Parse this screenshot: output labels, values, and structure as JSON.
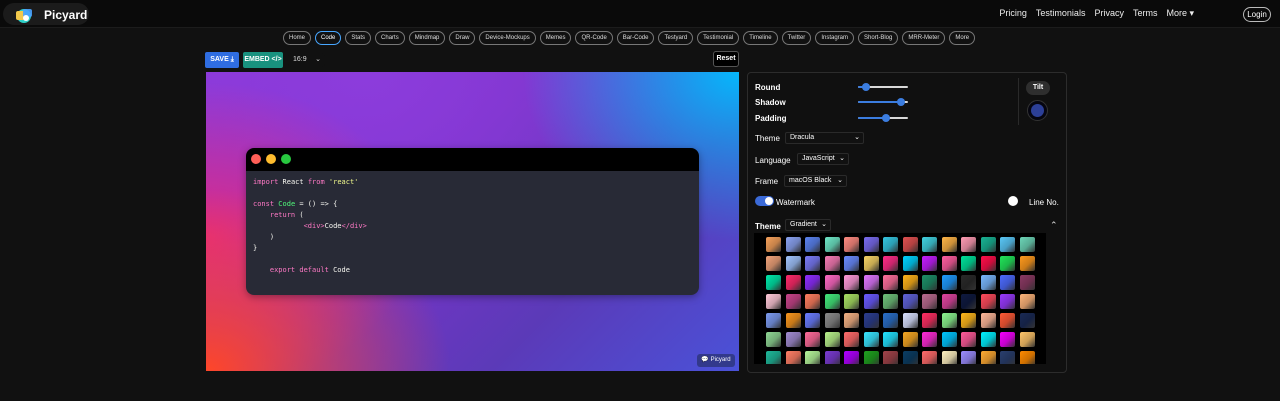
{
  "app": {
    "name": "Picyard"
  },
  "topnav": [
    "Pricing",
    "Testimonials",
    "Privacy",
    "Terms",
    "More ▾"
  ],
  "login_label": "Login",
  "tabs": [
    {
      "label": "Home"
    },
    {
      "label": "Code",
      "active": true
    },
    {
      "label": "Stats"
    },
    {
      "label": "Charts"
    },
    {
      "label": "Mindmap"
    },
    {
      "label": "Draw"
    },
    {
      "label": "Device-Mockups"
    },
    {
      "label": "Memes"
    },
    {
      "label": "QR-Code"
    },
    {
      "label": "Bar-Code"
    },
    {
      "label": "Testyard"
    },
    {
      "label": "Testimonial"
    },
    {
      "label": "Timeline"
    },
    {
      "label": "Twitter"
    },
    {
      "label": "Instagram"
    },
    {
      "label": "Short-Blog"
    },
    {
      "label": "MRR-Meter"
    },
    {
      "label": "More"
    }
  ],
  "toolbar": {
    "save_label": "SAVE ⤓",
    "embed_label": "EMBED </>",
    "ratio": "16:9",
    "reset_label": "Reset"
  },
  "code_lines": [
    [
      [
        "kw",
        "import "
      ],
      [
        "pl",
        "React "
      ],
      [
        "kw",
        "from "
      ],
      [
        "st",
        "'react'"
      ]
    ],
    [],
    [
      [
        "kw",
        "const "
      ],
      [
        "fn",
        "Code "
      ],
      [
        "pl",
        "= () => {"
      ]
    ],
    [
      [
        "pl",
        "    "
      ],
      [
        "kw",
        "return "
      ],
      [
        "pl",
        "("
      ]
    ],
    [
      [
        "pl",
        "            "
      ],
      [
        "kw",
        "<div>"
      ],
      [
        "pl",
        "Code"
      ],
      [
        "kw",
        "</div>"
      ]
    ],
    [
      [
        "pl",
        "    )"
      ]
    ],
    [
      [
        "pl",
        "}"
      ]
    ],
    [],
    [
      [
        "pl",
        "    "
      ],
      [
        "kw",
        "export default "
      ],
      [
        "pl",
        "Code"
      ]
    ]
  ],
  "watermark_badge": "Picyard",
  "controls": {
    "round_label": "Round",
    "round_value": 0.15,
    "shadow_label": "Shadow",
    "shadow_value": 0.85,
    "padding_label": "Padding",
    "padding_value": 0.55,
    "tilt_label": "Tilt",
    "theme_label": "Theme",
    "theme_value": "Dracula",
    "language_label": "Language",
    "language_value": "JavaScript",
    "frame_label": "Frame",
    "frame_value": "macOS Black",
    "watermark_label": "Watermark",
    "watermark_on": true,
    "lineno_label": "Line No.",
    "lineno_on": false,
    "bg_theme_label": "Theme",
    "bg_theme_value": "Gradient"
  },
  "colors": {
    "accent": "#3b7de0",
    "save": "#2f6de1",
    "embed": "#19927f",
    "active_tab": "#48a7ff"
  },
  "swatches": [
    [
      "#f6a15b",
      "#8ba3f2",
      "#5b83f0",
      "#6ee7c7",
      "#ff8a80",
      "#7a6cf0",
      "#35c6e0",
      "#e05151",
      "#41d1e0",
      "#ffb547",
      "#ff9bb3",
      "#19b394",
      "#5ac8f8",
      "#6dd6b8"
    ],
    [
      "#f0a37a",
      "#a1c4fd",
      "#7a7bf7",
      "#f77bb5",
      "#6a8cff",
      "#f6d365",
      "#ff2d87",
      "#00d2ff",
      "#c41eff",
      "#ff5ea0",
      "#00e19b",
      "#ff0f4a",
      "#22e55a",
      "#ff9a1e"
    ],
    [
      "#00e6a8",
      "#ff2a6a",
      "#8f2eff",
      "#ff69c4",
      "#ff9ad9",
      "#e077ff",
      "#ff6f9c",
      "#ffb31a",
      "#1e8f68",
      "#1f9bff",
      "#2a2a2a",
      "#7ab8ff",
      "#4d6cff",
      "#8a3a63"
    ],
    [
      "#ffc8d8",
      "#c7448a",
      "#ff7e5f",
      "#43e97b",
      "#a8e063",
      "#6a5aff",
      "#6ec17a",
      "#5f62d8",
      "#b96b8f",
      "#e0459f",
      "#0f1a40",
      "#ff4b5c",
      "#9a3aff",
      "#ffb57a"
    ],
    [
      "#7c9bf0",
      "#f8961e",
      "#6a7dff",
      "#8a8a8a",
      "#f4b183",
      "#2c3e8f",
      "#2a6fc9",
      "#d8e0ff",
      "#ff2e63",
      "#8bf58f",
      "#ffb81c",
      "#ffb89a",
      "#ff5a36",
      "#1a2a55"
    ],
    [
      "#8fd694",
      "#a18cd1",
      "#ff6b9a",
      "#b7f08a",
      "#ff6b6b",
      "#39e5ff",
      "#22e2ff",
      "#f5a623",
      "#ff2bd6",
      "#00c6ff",
      "#ff5a9a",
      "#00f0ff",
      "#f600ff",
      "#ffc56a"
    ],
    [
      "#1fb89a",
      "#ff7f66",
      "#b5f59a",
      "#7a3bd1",
      "#b000ff",
      "#20a020",
      "#a2434a",
      "#0b3d63",
      "#ff6b6b",
      "#fff1c1",
      "#9b8cff",
      "#ffaa33",
      "#2a3f6e",
      "#ff8a00"
    ]
  ]
}
